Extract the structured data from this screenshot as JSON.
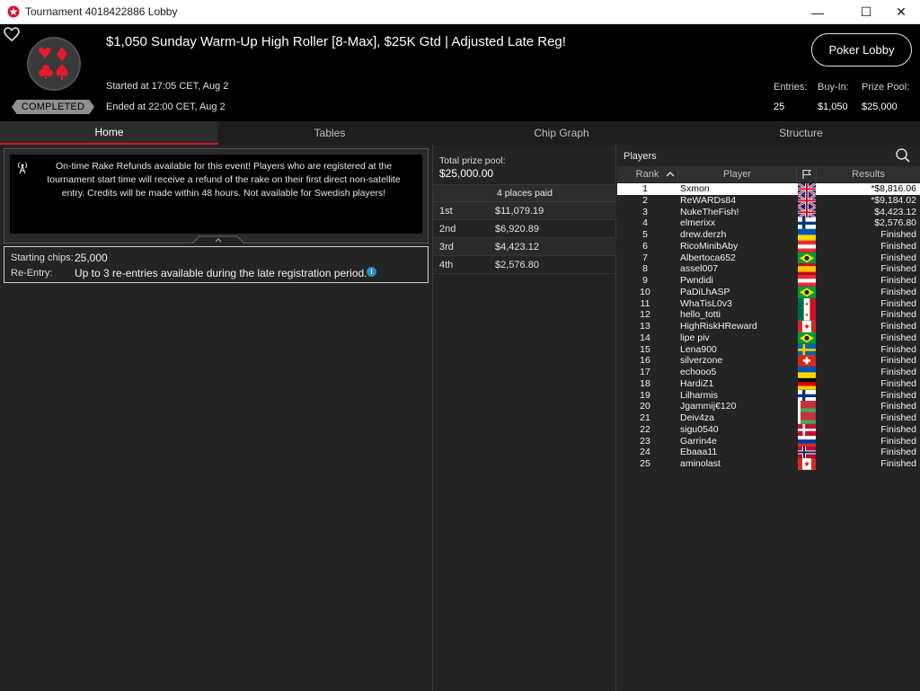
{
  "window": {
    "title": "Tournament 4018422886 Lobby",
    "minimize": "—",
    "maximize": "☐",
    "close": "✕"
  },
  "header": {
    "tournament_name": "$1,050 Sunday Warm-Up High Roller [8-Max], $25K Gtd | Adjusted Late Reg!",
    "status": "COMPLETED",
    "started": "Started at 17:05 CET, Aug 2",
    "ended": "Ended at 22:00 CET, Aug 2",
    "poker_lobby_label": "Poker Lobby",
    "entries_label": "Entries:",
    "entries_value": "25",
    "buyin_label": "Buy-In:",
    "buyin_value": "$1,050",
    "prizepool_label": "Prize Pool:",
    "prizepool_value": "$25,000"
  },
  "tabs": [
    {
      "label": "Home",
      "active": true
    },
    {
      "label": "Tables",
      "active": false
    },
    {
      "label": "Chip Graph",
      "active": false
    },
    {
      "label": "Structure",
      "active": false
    }
  ],
  "notice": {
    "text": "On-time Rake Refunds available for this event! Players who are registered at the tournament start time will receive a refund of the rake on their first direct non-satellite entry. Credits will be made within 48 hours. Not available for Swedish players!"
  },
  "info": {
    "starting_chips_label": "Starting chips:",
    "starting_chips_value": "25,000",
    "reentry_label": "Re-Entry:",
    "reentry_value": "Up to 3 re-entries available during the late registration period.",
    "info_glyph": "i"
  },
  "prizes": {
    "total_label": "Total prize pool:",
    "total_value": "$25,000.00",
    "places_paid": "4 places paid",
    "rows": [
      {
        "place": "1st",
        "amount": "$11,079.19"
      },
      {
        "place": "2nd",
        "amount": "$6,920.89"
      },
      {
        "place": "3rd",
        "amount": "$4,423.12"
      },
      {
        "place": "4th",
        "amount": "$2,576.80"
      }
    ]
  },
  "players": {
    "title": "Players",
    "col_rank": "Rank",
    "col_player": "Player",
    "col_results": "Results",
    "rows": [
      {
        "rank": "1",
        "name": "Sxmon",
        "flag": "uk",
        "result": "*$8,816.06"
      },
      {
        "rank": "2",
        "name": "ReWARDs84",
        "flag": "uk",
        "result": "*$9,184.02"
      },
      {
        "rank": "3",
        "name": "NukeTheFish!",
        "flag": "uk",
        "result": "$4,423.12"
      },
      {
        "rank": "4",
        "name": "elmerixx",
        "flag": "fi",
        "result": "$2,576.80"
      },
      {
        "rank": "5",
        "name": "drew.derzh",
        "flag": "ua",
        "result": "Finished"
      },
      {
        "rank": "6",
        "name": "RicoMinibAby",
        "flag": "at",
        "result": "Finished"
      },
      {
        "rank": "7",
        "name": "Albertoca652",
        "flag": "br",
        "result": "Finished"
      },
      {
        "rank": "8",
        "name": "assel007",
        "flag": "es",
        "result": "Finished"
      },
      {
        "rank": "9",
        "name": "Pwndidi",
        "flag": "at",
        "result": "Finished"
      },
      {
        "rank": "10",
        "name": "PaDiLhASP",
        "flag": "br",
        "result": "Finished"
      },
      {
        "rank": "11",
        "name": "WhaTisL0v3",
        "flag": "mx",
        "result": "Finished"
      },
      {
        "rank": "12",
        "name": "hello_totti",
        "flag": "mx",
        "result": "Finished"
      },
      {
        "rank": "13",
        "name": "HighRiskHReward",
        "flag": "ca",
        "result": "Finished"
      },
      {
        "rank": "14",
        "name": "lipe piv",
        "flag": "br",
        "result": "Finished"
      },
      {
        "rank": "15",
        "name": "Lena900",
        "flag": "se",
        "result": "Finished"
      },
      {
        "rank": "16",
        "name": "silverzone",
        "flag": "ch",
        "result": "Finished"
      },
      {
        "rank": "17",
        "name": "echooo5",
        "flag": "ua",
        "result": "Finished"
      },
      {
        "rank": "18",
        "name": "HardiZ1",
        "flag": "de",
        "result": "Finished"
      },
      {
        "rank": "19",
        "name": "Lilharmis",
        "flag": "fi",
        "result": "Finished"
      },
      {
        "rank": "20",
        "name": "Jgammij€120",
        "flag": "by",
        "result": "Finished"
      },
      {
        "rank": "21",
        "name": "Deiv4za",
        "flag": "by",
        "result": "Finished"
      },
      {
        "rank": "22",
        "name": "sigu0540",
        "flag": "dk",
        "result": "Finished"
      },
      {
        "rank": "23",
        "name": "Garrin4e",
        "flag": "ru",
        "result": "Finished"
      },
      {
        "rank": "24",
        "name": "Ebaaa11",
        "flag": "no",
        "result": "Finished"
      },
      {
        "rank": "25",
        "name": "aminolast",
        "flag": "ca",
        "result": "Finished"
      }
    ]
  },
  "colors": {
    "accent_red": "#d3162a",
    "header_bg": "#000000",
    "panel_bg": "#242424",
    "selected_row_bg": "#ffffff",
    "badge_gray": "#8f8f8f",
    "info_blue": "#2a8ec6"
  },
  "icons": {
    "app": "pokerstars-logo-icon",
    "favorite": "heart-icon",
    "logo": "card-suits-icon",
    "notice": "broadcast-icon",
    "search": "search-icon",
    "sort": "sort-up-icon",
    "flag_column": "flag-icon"
  }
}
